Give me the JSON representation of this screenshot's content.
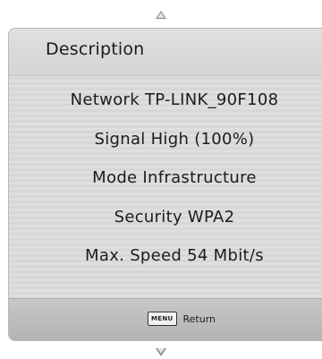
{
  "dialog": {
    "title": "Description",
    "info": [
      "Network TP-LINK_90F108",
      "Signal High (100%)",
      "Mode Infrastructure",
      "Security WPA2",
      "Max. Speed 54 Mbit/s"
    ]
  },
  "footer": {
    "menu_key_label": "MENU",
    "return_label": "Return"
  },
  "icons": {
    "up": "scroll-up-arrow-icon",
    "down": "scroll-down-arrow-icon"
  }
}
